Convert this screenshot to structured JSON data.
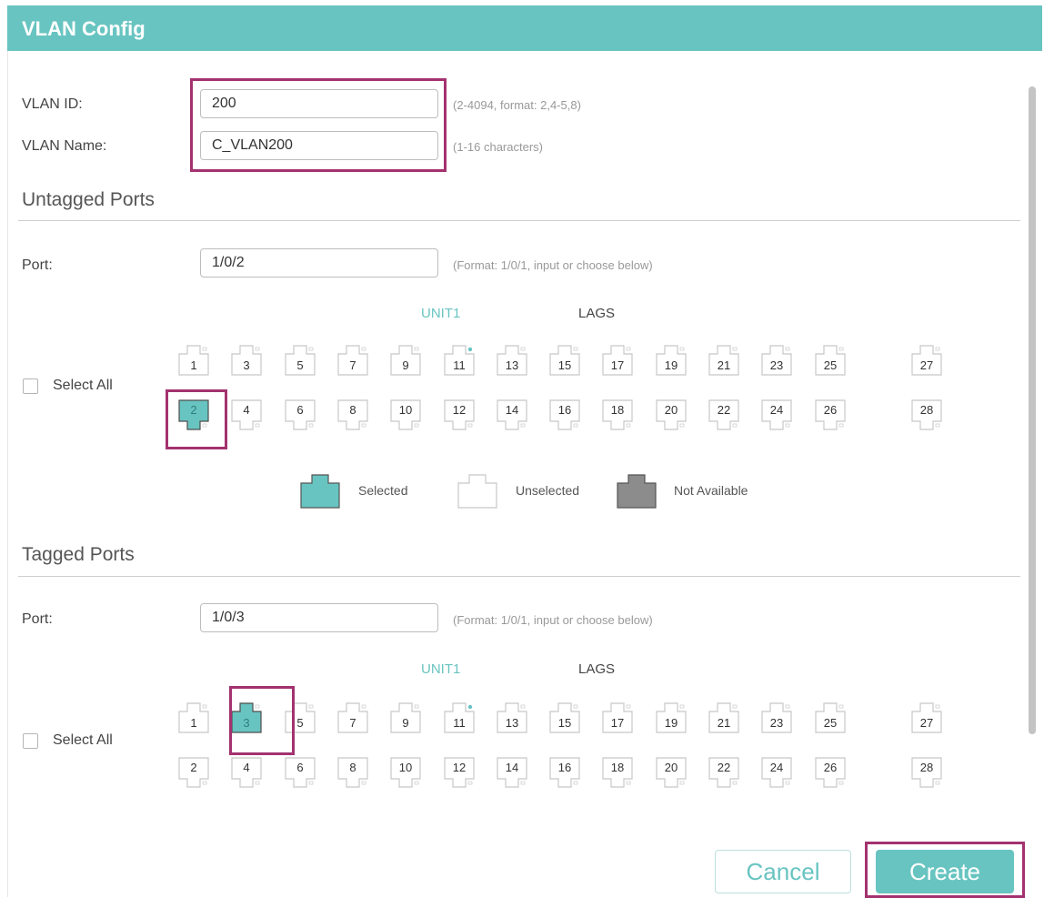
{
  "dialog": {
    "title": "VLAN Config"
  },
  "form": {
    "vlan_id_label": "VLAN ID:",
    "vlan_id_value": "200",
    "vlan_id_hint": "(2-4094, format: 2,4-5,8)",
    "vlan_name_label": "VLAN Name:",
    "vlan_name_value": "C_VLAN200",
    "vlan_name_hint": "(1-16 characters)"
  },
  "untagged": {
    "title": "Untagged Ports",
    "port_label": "Port:",
    "port_value": "1/0/2",
    "port_hint": "(Format: 1/0/1, input or choose below)",
    "tab_unit": "UNIT1",
    "tab_lags": "LAGS",
    "select_all": "Select All",
    "selected_ports": [
      "2"
    ]
  },
  "tagged": {
    "title": "Tagged Ports",
    "port_label": "Port:",
    "port_value": "1/0/3",
    "port_hint": "(Format: 1/0/1, input or choose below)",
    "tab_unit": "UNIT1",
    "tab_lags": "LAGS",
    "select_all": "Select All",
    "selected_ports": [
      "3"
    ]
  },
  "ports": {
    "odd": [
      "1",
      "3",
      "5",
      "7",
      "9",
      "11",
      "13",
      "15",
      "17",
      "19",
      "21",
      "23",
      "25",
      "27"
    ],
    "even": [
      "2",
      "4",
      "6",
      "8",
      "10",
      "12",
      "14",
      "16",
      "18",
      "20",
      "22",
      "24",
      "26",
      "28"
    ],
    "active_indicator_port": "11"
  },
  "legend": {
    "selected": "Selected",
    "unselected": "Unselected",
    "not_available": "Not Available"
  },
  "colors": {
    "accent": "#68c4c1",
    "highlight": "#a3326f",
    "not_available": "#8c8c8c"
  },
  "buttons": {
    "cancel": "Cancel",
    "create": "Create"
  }
}
